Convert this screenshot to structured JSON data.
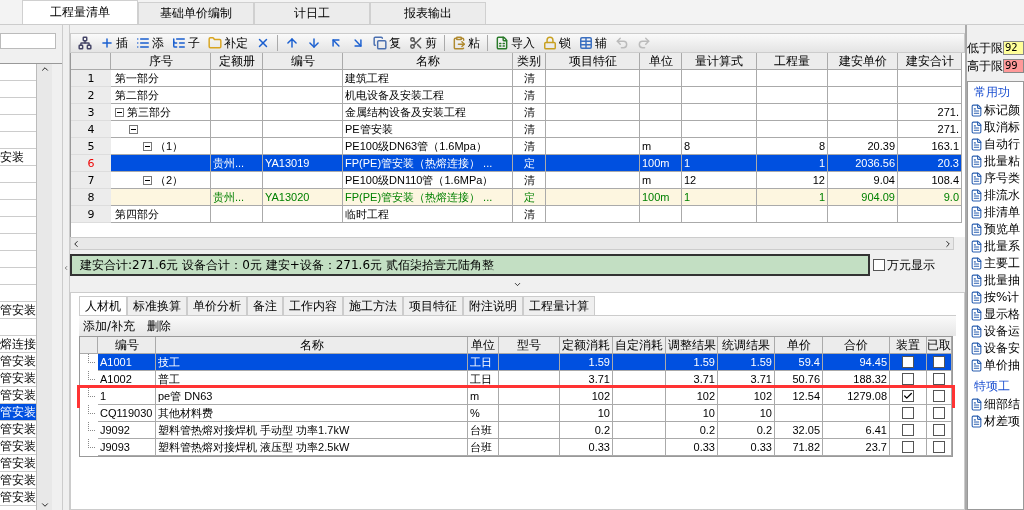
{
  "top_tabs": [
    {
      "label": "工程量清单",
      "selected": true
    },
    {
      "label": "基础单价编制",
      "selected": false
    },
    {
      "label": "计日工",
      "selected": false
    },
    {
      "label": "报表输出",
      "selected": false
    }
  ],
  "left_list": [
    {
      "selected": false
    },
    {
      "selected": false
    },
    {
      "selected": false
    },
    {
      "selected": false
    },
    {
      "selected": false
    },
    {
      "label": "安装",
      "selected": false
    },
    {
      "selected": false
    },
    {
      "selected": false
    },
    {
      "selected": false
    },
    {
      "selected": false
    },
    {
      "selected": false
    },
    {
      "selected": false
    },
    {
      "selected": false
    },
    {
      "selected": false
    },
    {
      "label": "管安装",
      "selected": false
    },
    {
      "selected": false
    },
    {
      "label": "熔连接",
      "selected": false
    },
    {
      "label": "管安装",
      "selected": false
    },
    {
      "label": "管安装",
      "selected": false
    },
    {
      "label": "管安装",
      "selected": false
    },
    {
      "label": "管安装",
      "selected": true
    },
    {
      "label": "管安装",
      "selected": false
    },
    {
      "label": "管安装",
      "selected": false
    },
    {
      "label": "管安装",
      "selected": false
    },
    {
      "label": "管安装",
      "selected": false
    },
    {
      "label": "管安装",
      "selected": false
    }
  ],
  "toolbar": [
    {
      "disabled": false
    },
    {
      "label": "插",
      "disabled": false
    },
    {
      "label": "添",
      "disabled": false
    },
    {
      "label": "子",
      "disabled": false
    },
    {
      "label": "补定",
      "disabled": false
    },
    {
      "disabled": false
    },
    {
      "disabled": false
    },
    {
      "disabled": false
    },
    {
      "disabled": false
    },
    {
      "disabled": false
    },
    {
      "label": "复",
      "disabled": false
    },
    {
      "label": "剪",
      "disabled": false
    },
    {
      "label": "粘",
      "disabled": false
    },
    {
      "label": "导入",
      "disabled": false
    },
    {
      "label": "锁",
      "disabled": false
    },
    {
      "label": "辅",
      "disabled": false
    },
    {
      "disabled": true
    },
    {
      "disabled": true
    }
  ],
  "grid": {
    "columns": [
      "序号",
      "定额册",
      "编号",
      "名称",
      "类别",
      "项目特征",
      "单位",
      "量计算式",
      "工程量",
      "建安单价",
      "建安合计"
    ],
    "rows": [
      {
        "no": "1",
        "seq": "第一部分",
        "name": "建筑工程",
        "category": "清",
        "kind": "bill",
        "selected": false
      },
      {
        "no": "2",
        "seq": "第二部分",
        "name": "机电设备及安装工程",
        "category": "清",
        "kind": "bill",
        "selected": false
      },
      {
        "no": "3",
        "seq": "第三部分",
        "name": "金属结构设备及安装工程",
        "category": "清",
        "total": "271.",
        "kind": "bill",
        "selected": false,
        "expanded": true,
        "children": [
          {
            "no": "4",
            "name": "PE管安装",
            "category": "清",
            "total": "271.",
            "kind": "bill",
            "selected": false,
            "expanded": true,
            "children": [
              {
                "no": "5",
                "seq": "（1）",
                "name": "PE100级DN63管（1.6Mpa）",
                "category": "清",
                "unit": "m",
                "formula": "8",
                "quantity": "8",
                "unit_price": "20.39",
                "total": "163.1",
                "kind": "bill",
                "selected": false,
                "expanded": true,
                "children": [
                  {
                    "no": "6",
                    "quota_book": "贵州...",
                    "code": "YA13019",
                    "name": "FP(PE)管安装（热熔连接） ...",
                    "category": "定",
                    "unit": "100m",
                    "formula": "1",
                    "quantity": "1",
                    "unit_price": "2036.56",
                    "total": "20.3",
                    "kind": "quota",
                    "selected": true
                  }
                ]
              },
              {
                "no": "7",
                "seq": "（2）",
                "name": "PE100级DN110管（1.6MPa）",
                "category": "清",
                "unit": "m",
                "formula": "12",
                "quantity": "12",
                "unit_price": "9.04",
                "total": "108.4",
                "kind": "bill",
                "selected": false,
                "expanded": true,
                "children": [
                  {
                    "no": "8",
                    "quota_book": "贵州...",
                    "code": "YA13020",
                    "name": "FP(PE)管安装（热熔连接） ...",
                    "category": "定",
                    "unit": "100m",
                    "formula": "1",
                    "quantity": "1",
                    "unit_price": "904.09",
                    "total": "9.0",
                    "kind": "quota",
                    "selected": false
                  }
                ]
              }
            ]
          }
        ]
      },
      {
        "no": "9",
        "seq": "第四部分",
        "name": "临时工程",
        "category": "清",
        "kind": "bill",
        "selected": false
      }
    ]
  },
  "summary": "建安合计:271.6元 设备合计：0元 建安+设备：271.6元   贰佰柒拾壹元陆角整",
  "wan_display": {
    "label": "万元显示",
    "checked": false
  },
  "detail_tabs": [
    {
      "label": "人材机",
      "selected": true
    },
    {
      "label": "标准换算",
      "selected": false
    },
    {
      "label": "单价分析",
      "selected": false
    },
    {
      "label": "备注",
      "selected": false
    },
    {
      "label": "工作内容",
      "selected": false
    },
    {
      "label": "施工方法",
      "selected": false
    },
    {
      "label": "项目特征",
      "selected": false
    },
    {
      "label": "附注说明",
      "selected": false
    },
    {
      "label": "工程量计算",
      "selected": false
    }
  ],
  "detail_actions": [
    "添加/补充",
    "删除"
  ],
  "resources": {
    "columns": [
      "编号",
      "名称",
      "单位",
      "型号",
      "定额消耗",
      "自定消耗",
      "调整结果",
      "统调结果",
      "单价",
      "合价",
      "装置",
      "已取"
    ],
    "rows": [
      {
        "code": "A1001",
        "name": "技工",
        "unit": "工日",
        "quota": "1.59",
        "adjusted": "1.59",
        "unified": "1.59",
        "price": "59.4",
        "amount": "94.45",
        "device": false,
        "taken": false,
        "selected": true,
        "highlighted": false
      },
      {
        "code": "A1002",
        "name": "普工",
        "unit": "工日",
        "quota": "3.71",
        "adjusted": "3.71",
        "unified": "3.71",
        "price": "50.76",
        "amount": "188.32",
        "device": false,
        "taken": false,
        "selected": false,
        "highlighted": false
      },
      {
        "code": "1",
        "name": "pe管 DN63",
        "unit": "m",
        "quota": "102",
        "adjusted": "102",
        "unified": "102",
        "price": "12.54",
        "amount": "1279.08",
        "device": true,
        "taken": false,
        "selected": false,
        "highlighted": true
      },
      {
        "code": "CQ119030",
        "name": "其他材料费",
        "unit": "%",
        "quota": "10",
        "adjusted": "10",
        "unified": "10",
        "device": false,
        "taken": false,
        "selected": false,
        "highlighted": false
      },
      {
        "code": "J9092",
        "name": "塑料管热熔对接焊机 手动型 功率1.7kW",
        "unit": "台班",
        "quota": "0.2",
        "adjusted": "0.2",
        "unified": "0.2",
        "price": "32.05",
        "amount": "6.41",
        "device": false,
        "taken": false,
        "selected": false,
        "highlighted": false
      },
      {
        "code": "J9093",
        "name": "塑料管热熔对接焊机 液压型 功率2.5kW",
        "unit": "台班",
        "quota": "0.33",
        "adjusted": "0.33",
        "unified": "0.33",
        "price": "71.82",
        "amount": "23.7",
        "device": false,
        "taken": false,
        "selected": false,
        "highlighted": false
      }
    ]
  },
  "limits": [
    {
      "label": "低于限",
      "value": "92",
      "color": "#ffff99"
    },
    {
      "label": "高于限",
      "value": "99",
      "color": "#ff9999"
    }
  ],
  "function_sections": [
    {
      "title": "常用功",
      "items": [
        "标记颜",
        "取消标",
        "自动行",
        "批量粘",
        "序号类",
        "排流水",
        "排清单",
        "预览单",
        "批量系",
        "主要工",
        "批量抽",
        "按%计",
        "显示格",
        "设备运",
        "设备安",
        "单价抽"
      ]
    },
    {
      "title": "特项工",
      "items": [
        "细部结",
        "材差项"
      ]
    }
  ]
}
